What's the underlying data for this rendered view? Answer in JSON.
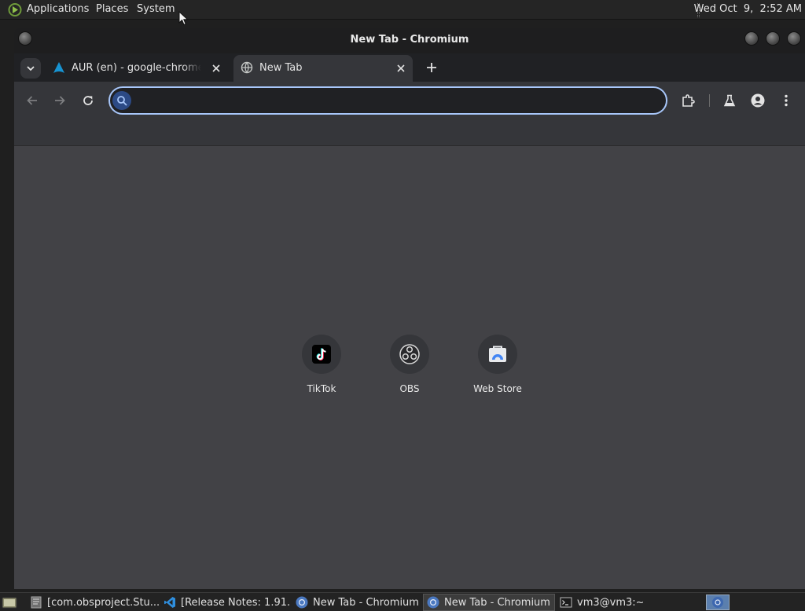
{
  "top_panel": {
    "menus": [
      "Applications",
      "Places",
      "System"
    ],
    "clock": "Wed Oct  9,  2:52 AM"
  },
  "window": {
    "title": "New Tab - Chromium"
  },
  "tabs": [
    {
      "title": "AUR (en) - google-chrome-dev",
      "favicon": "arch-icon",
      "active": false
    },
    {
      "title": "New Tab",
      "favicon": "globe-icon",
      "active": true
    }
  ],
  "omnibox": {
    "value": "",
    "placeholder": ""
  },
  "shortcuts": [
    {
      "label": "TikTok",
      "icon": "tiktok-icon"
    },
    {
      "label": "OBS",
      "icon": "obs-icon"
    },
    {
      "label": "Web Store",
      "icon": "web-store-icon"
    }
  ],
  "taskbar": {
    "tasks": [
      {
        "label": "[com.obsproject.Stu...",
        "icon": "obs-app-icon",
        "active": false
      },
      {
        "label": "[Release Notes: 1.91...",
        "icon": "vscode-icon",
        "active": false
      },
      {
        "label": "New Tab - Chromium",
        "icon": "chromium-icon",
        "active": false
      },
      {
        "label": "New Tab - Chromium",
        "icon": "chromium-icon",
        "active": true
      },
      {
        "label": "vm3@vm3:~",
        "icon": "terminal-icon",
        "active": false
      }
    ]
  },
  "colors": {
    "ntp_background": "#424246",
    "toolbar": "#35363a",
    "omnibox_focus_ring": "#a8c7fa",
    "workspace_active": "#5b7fae"
  }
}
